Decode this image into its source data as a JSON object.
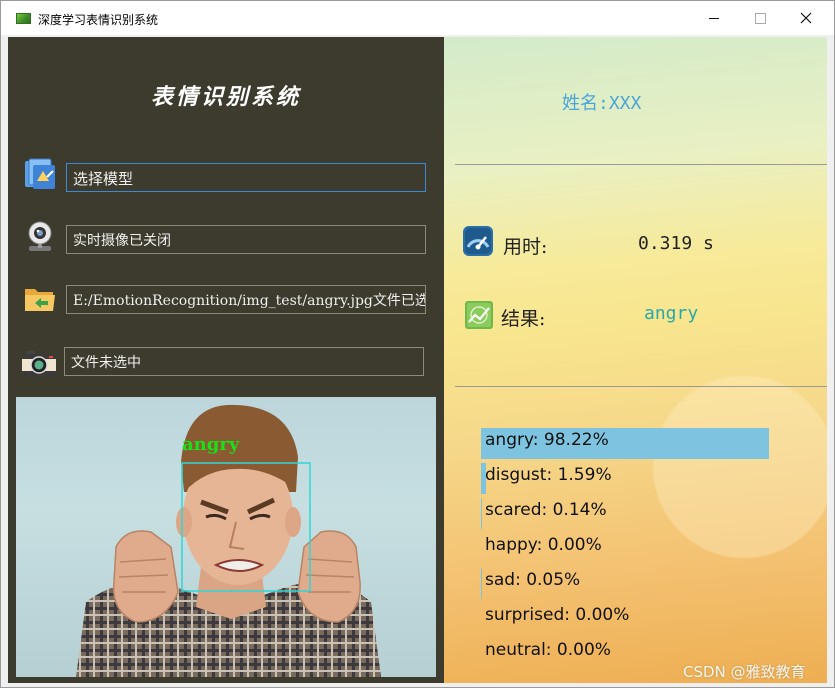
{
  "window": {
    "title": "深度学习表情识别系统",
    "buttons": {
      "minimize": "minimize",
      "maximize": "maximize",
      "close": "close"
    }
  },
  "left": {
    "app_title": "表情识别系统",
    "rows": [
      {
        "icon": "folder-blue-icon",
        "text": "选择模型"
      },
      {
        "icon": "webcam-icon",
        "text": "实时摄像已关闭"
      },
      {
        "icon": "folder-open-icon",
        "text": "E:/EmotionRecognition/img_test/angry.jpg文件已选中"
      },
      {
        "icon": "camera-icon",
        "text": "文件未选中"
      }
    ],
    "photo": {
      "detection_label": "angry",
      "box_color": "#2fd6d6",
      "label_color": "#19e019"
    }
  },
  "right": {
    "name_label": "姓名:XXX",
    "time_label": "用时:",
    "time_value": "0.319 s",
    "result_label": "结果:",
    "result_value": "angry",
    "probabilities": [
      {
        "label": "angry: 98.22%",
        "value": 98.22
      },
      {
        "label": "disgust: 1.59%",
        "value": 1.59
      },
      {
        "label": "scared: 0.14%",
        "value": 0.14
      },
      {
        "label": "happy: 0.00%",
        "value": 0.0
      },
      {
        "label": "sad: 0.05%",
        "value": 0.05
      },
      {
        "label": "surprised: 0.00%",
        "value": 0.0
      },
      {
        "label": "neutral: 0.00%",
        "value": 0.0
      }
    ],
    "bar_color": "#7ec4e0"
  },
  "watermark": "CSDN @雅致教育"
}
